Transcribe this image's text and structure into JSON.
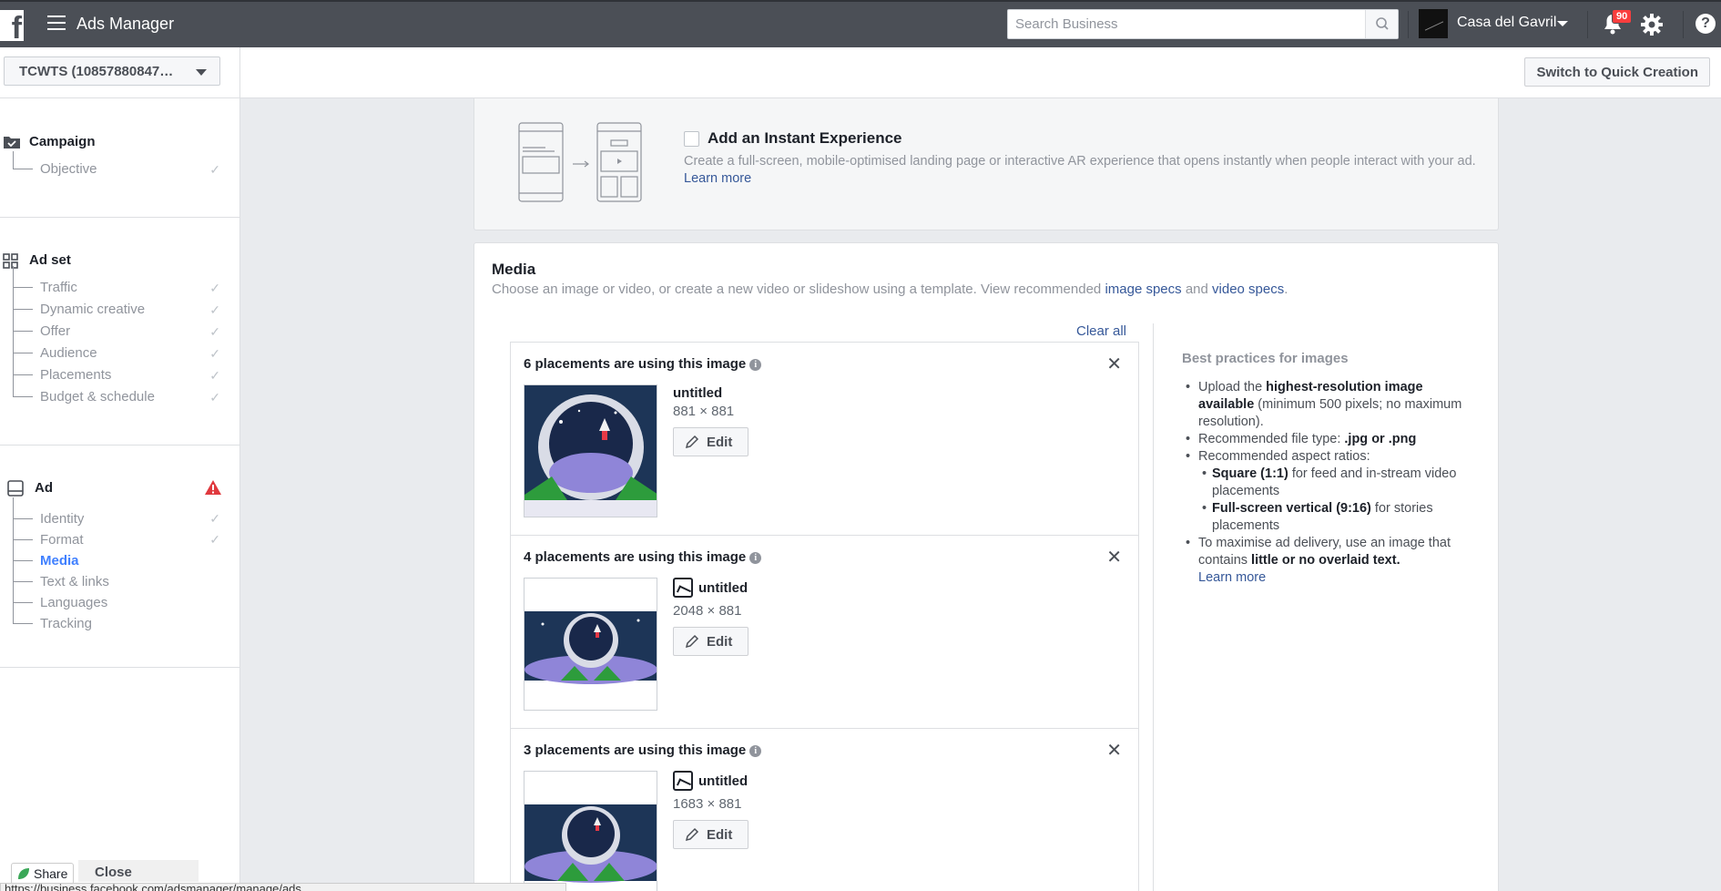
{
  "topbar": {
    "app_title": "Ads Manager",
    "search_placeholder": "Search Business",
    "account_name": "Casa del Gavril",
    "notification_count": "90"
  },
  "subbar": {
    "account_selector": "TCWTS (10857880847…",
    "quick_creation_label": "Switch to Quick Creation"
  },
  "sidebar": {
    "campaign": {
      "label": "Campaign",
      "items": [
        {
          "label": "Objective",
          "done": true
        }
      ]
    },
    "adset": {
      "label": "Ad set",
      "items": [
        {
          "label": "Traffic",
          "done": true
        },
        {
          "label": "Dynamic creative",
          "done": true
        },
        {
          "label": "Offer",
          "done": true
        },
        {
          "label": "Audience",
          "done": true
        },
        {
          "label": "Placements",
          "done": true
        },
        {
          "label": "Budget & schedule",
          "done": true
        }
      ]
    },
    "ad": {
      "label": "Ad",
      "has_warning": true,
      "items": [
        {
          "label": "Identity",
          "done": true
        },
        {
          "label": "Format",
          "done": true
        },
        {
          "label": "Media",
          "active": true
        },
        {
          "label": "Text & links"
        },
        {
          "label": "Languages"
        },
        {
          "label": "Tracking"
        }
      ]
    }
  },
  "instant_experience": {
    "title": "Add an Instant Experience",
    "description": "Create a full-screen, mobile-optimised landing page or interactive AR experience that opens instantly when people interact with your ad.",
    "learn_more": "Learn more",
    "checked": false
  },
  "media": {
    "title": "Media",
    "description_prefix": "Choose an image or video, or create a new video or slideshow using a template. View recommended",
    "image_specs": "image specs",
    "and": "and",
    "video_specs": "video specs",
    "period": ".",
    "clear_all": "Clear all",
    "placements": [
      {
        "title": "6 placements are using this image",
        "name": "untitled",
        "size": "881 × 881",
        "edit": "Edit"
      },
      {
        "title": "4 placements are using this image",
        "name": "untitled",
        "size": "2048 × 881",
        "edit": "Edit"
      },
      {
        "title": "3 placements are using this image",
        "name": "untitled",
        "size": "1683 × 881",
        "edit": "Edit"
      }
    ]
  },
  "best_practices": {
    "title": "Best practices for images",
    "b1_pre": "Upload the ",
    "b1_bold": "highest-resolution image available",
    "b1_post": " (minimum 500 pixels; no maximum resolution).",
    "b2_pre": "Recommended file type: ",
    "b2_bold": ".jpg or .png",
    "b3": "Recommended aspect ratios:",
    "b3a_bold": "Square (1:1)",
    "b3a_post": " for feed and in-stream video placements",
    "b3b_bold": "Full-screen vertical (9:16)",
    "b3b_post": " for stories placements",
    "b4_pre": "To maximise ad delivery, use an image that contains ",
    "b4_bold": "little or no overlaid text.",
    "b4_link": "Learn more"
  },
  "bottom": {
    "share": "Share",
    "close": "Close",
    "url": "https://business.facebook.com/adsmanager/manage/ads"
  },
  "colors": {
    "topbar": "#4b4f56",
    "link": "#365899",
    "active_nav": "#4080ff",
    "warning": "#e0393e"
  }
}
